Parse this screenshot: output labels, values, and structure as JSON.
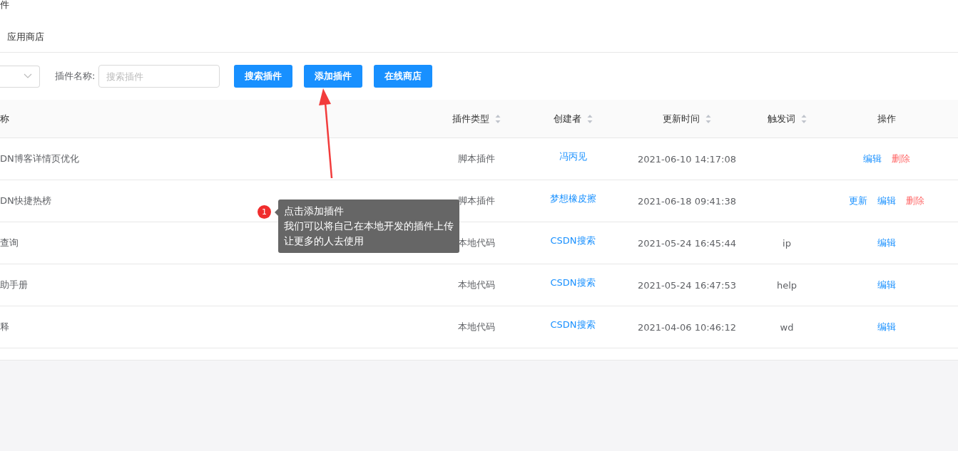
{
  "page_title": "件",
  "tabs": [
    {
      "label": "应用商店",
      "selected": false
    }
  ],
  "filters": {
    "name_label": "插件名称:",
    "name_placeholder": "搜索插件"
  },
  "buttons": [
    {
      "label": "搜索插件"
    },
    {
      "label": "添加插件"
    },
    {
      "label": "在线商店"
    }
  ],
  "table": {
    "columns": [
      {
        "label": "称",
        "kind": "plain"
      },
      {
        "label": "插件类型",
        "kind": "sortable"
      },
      {
        "label": "创建者",
        "kind": "sortable"
      },
      {
        "label": "更新时间",
        "kind": "sortable"
      },
      {
        "label": "触发词",
        "kind": "sortable"
      },
      {
        "label": "操作",
        "kind": "plain"
      }
    ],
    "rows": [
      {
        "name": "DN博客详情页优化",
        "type": "脚本插件",
        "creator": "冯丙见",
        "updated": "2021-06-10 14:17:08",
        "trigger": "",
        "actions": [
          {
            "label": "编辑",
            "kind": "edit"
          },
          {
            "label": "删除",
            "kind": "delete"
          }
        ]
      },
      {
        "name": "DN快捷热榜",
        "type": "脚本插件",
        "creator": "梦想橡皮擦",
        "updated": "2021-06-18 09:41:38",
        "trigger": "",
        "actions": [
          {
            "label": "更新",
            "kind": "edit"
          },
          {
            "label": "编辑",
            "kind": "edit"
          },
          {
            "label": "删除",
            "kind": "delete"
          }
        ]
      },
      {
        "name": "查询",
        "type": "本地代码",
        "creator": "CSDN搜索",
        "updated": "2021-05-24 16:45:44",
        "trigger": "ip",
        "actions": [
          {
            "label": "编辑",
            "kind": "edit"
          }
        ]
      },
      {
        "name": "助手册",
        "type": "本地代码",
        "creator": "CSDN搜索",
        "updated": "2021-05-24 16:47:53",
        "trigger": "help",
        "actions": [
          {
            "label": "编辑",
            "kind": "edit"
          }
        ]
      },
      {
        "name": "释",
        "type": "本地代码",
        "creator": "CSDN搜索",
        "updated": "2021-04-06 10:46:12",
        "trigger": "wd",
        "actions": [
          {
            "label": "编辑",
            "kind": "edit"
          }
        ]
      }
    ]
  },
  "callout": {
    "number": "1",
    "lines": [
      "点击添加插件",
      "我们可以将自己在本地开发的插件上传",
      "让更多的人去使用"
    ]
  }
}
